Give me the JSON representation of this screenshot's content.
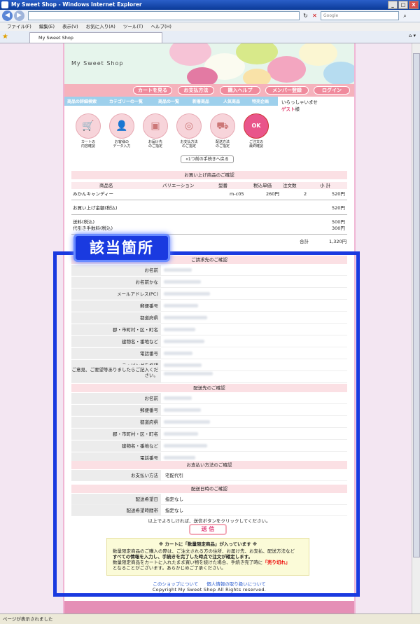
{
  "window": {
    "title": "My Sweet Shop - Windows Internet Explorer",
    "min": "_",
    "max": "□",
    "close": "X"
  },
  "browser": {
    "search_placeholder": "Google",
    "menu": [
      "ファイル(F)",
      "編集(E)",
      "表示(V)",
      "お気に入り(A)",
      "ツール(T)",
      "ヘルプ(H)"
    ],
    "tab_title": "My Sweet Shop",
    "status": "ページが表示されました"
  },
  "shop": {
    "name": "My Sweet Shop",
    "nav_buttons": [
      "カートを見る",
      "お支払方法",
      "購入ヘルプ",
      "メンバー登録",
      "ログイン"
    ],
    "categories": [
      "商品の詳細検索",
      "カテゴリーの一覧",
      "商品の一覧",
      "新着商品",
      "人気商品",
      "特売企画"
    ],
    "welcome": "いらっしゃいませ",
    "guest_name": "ゲスト",
    "guest_suffix": "様"
  },
  "steps": [
    {
      "line1": "カートの",
      "line2": "内容確認"
    },
    {
      "line1": "お客様の",
      "line2": "データ入力"
    },
    {
      "line1": "お届け先",
      "line2": "のご指定"
    },
    {
      "line1": "お支払方法",
      "line2": "のご指定"
    },
    {
      "line1": "配送方法",
      "line2": "のご指定"
    },
    {
      "line1": "ご注文の",
      "line2": "最終確認"
    }
  ],
  "back_button": "«1つ前の手続きへ戻る",
  "order": {
    "heading": "お買い上げ商品のご確認",
    "columns": [
      "商品名",
      "バリエーション",
      "型番",
      "税込単価",
      "注文数",
      "小 計"
    ],
    "item": {
      "name": "みかんキャンディー",
      "variation": "",
      "model": "m-c05",
      "price": "260円",
      "qty": "2",
      "subtotal": "520円"
    },
    "total_label": "お買い上げ金額(税込)",
    "total_value": "520円",
    "shipping_label": "送料(税込)",
    "shipping_value": "500円",
    "cod_label": "代引き手数料(税込)",
    "cod_value": "300円",
    "grand_label": "合計",
    "grand_value": "1,320円"
  },
  "billing": {
    "heading": "ご請求先のご確認",
    "fields": [
      "お名前",
      "お名前かな",
      "メールアドレス(PC)",
      "郵便番号",
      "都道府県",
      "郡・市町村・区・町名",
      "建物名・番地など",
      "電話番号",
      "ラッピングを希望"
    ],
    "comment_label": "ご意見、ご要望等ありましたらご記入ください。"
  },
  "shipping": {
    "heading": "配送先のご確認",
    "fields": [
      "お名前",
      "郵便番号",
      "都道府県",
      "郡・市町村・区・町名",
      "建物名・番地など",
      "電話番号"
    ]
  },
  "payment": {
    "heading": "お支払い方法のご確認",
    "label": "お支払い方法",
    "value": "宅配代引"
  },
  "delivery": {
    "heading": "配送日時のご確認",
    "date_label": "配送希望日",
    "date_value": "指定なし",
    "time_label": "配送希望時間帯",
    "time_value": "指定なし"
  },
  "confirm_text": "以上でよろしければ、送信ボタンをクリックしてください。",
  "send_button": "送 信",
  "notice": {
    "title": "※ カートに「数量限定商品」が入っています ※",
    "line1": "数量限定商品のご購入の際は、ご注文される方の住所、お届け先、お支払、配送方法など",
    "line2": "すべての情報を入力し、手続きを完了した時点で注文が確定します。",
    "line3a": "数量限定商品をカートに入れたまま買い物を続けた場合、手続き完了時に",
    "line3_red": "「売り切れ」",
    "line4": "となることがございます。あらかじめご了承ください。"
  },
  "footer": {
    "links": [
      "このショップについて",
      "個人情報の取り扱いについて"
    ],
    "copyright": "Copyright My Sweet Shop All Rights reserved."
  },
  "annotation": {
    "label": "該当箇所",
    "color": "#1a3ae0"
  }
}
